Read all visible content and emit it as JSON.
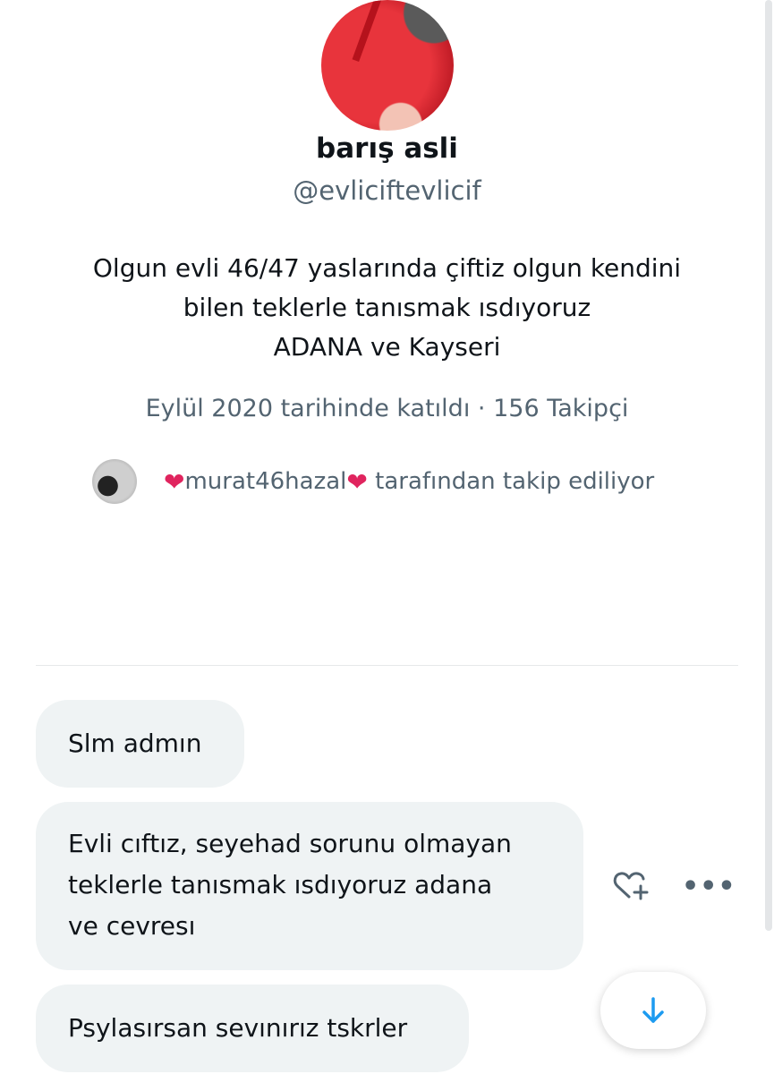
{
  "profile": {
    "display_name": "barış asli",
    "handle": "@evliciftevlicif",
    "bio": [
      "Olgun evli 46/47 yaslarında çiftiz olgun kendini",
      "bilen teklerle tanısmak ısdıyoruz",
      "ADANA ve Kayseri"
    ],
    "joined": "Eylül 2020 tarihinde katıldı",
    "separator": "·",
    "followers": "156 Takipçi",
    "followed_by": {
      "heart_left": "❤",
      "name": "murat46hazal",
      "heart_right": "❤",
      "suffix": " tarafından takip ediliyor"
    }
  },
  "messages": [
    {
      "lines": [
        "Slm admın"
      ]
    },
    {
      "lines": [
        "Evli cıftız, seyehad sorunu olmayan",
        "teklerle tanısmak ısdıyoruz adana",
        "ve cevresı"
      ]
    },
    {
      "lines": [
        "Psylasırsan sevınırız tskrler"
      ]
    }
  ],
  "actions": {
    "more_label": "•••"
  },
  "icons": {
    "react": "heart-plus-icon",
    "more": "more-icon",
    "scroll": "arrow-down-icon"
  },
  "colors": {
    "accent": "#1d9bf0",
    "secondary_text": "#536471",
    "bubble": "#eff3f4",
    "heart": "#e0245e"
  }
}
